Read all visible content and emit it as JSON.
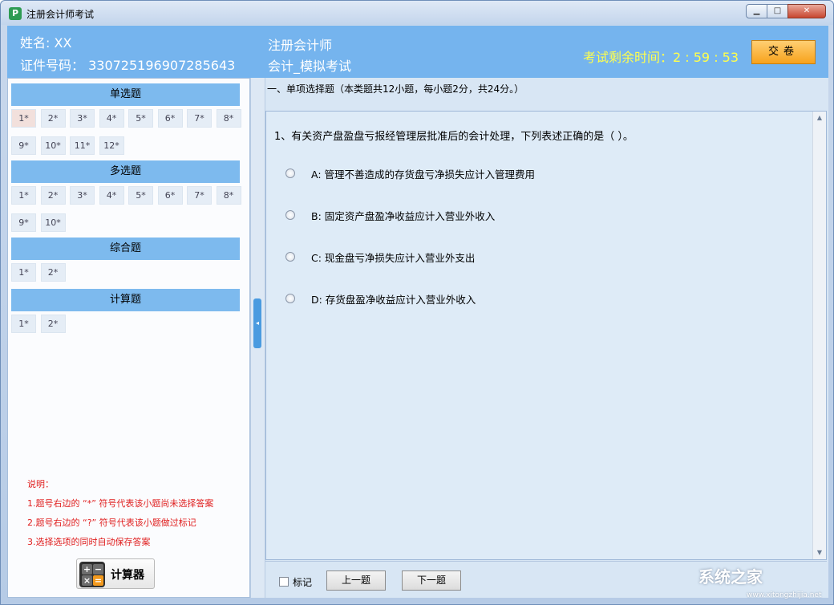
{
  "window": {
    "title": "注册会计师考试",
    "icon_letter": "P"
  },
  "header": {
    "name_label": "姓名:  XX",
    "id_label": "证件号码：  330725196907285643",
    "exam_name": "注册会计师",
    "exam_type": "会计_模拟考试",
    "timer": "考试剩余时间：2 : 59 : 53",
    "submit_label": "交卷"
  },
  "sections": [
    {
      "title": "单选题",
      "items": [
        "1*",
        "2*",
        "3*",
        "4*",
        "5*",
        "6*",
        "7*",
        "8*",
        "9*",
        "10*",
        "11*",
        "12*"
      ]
    },
    {
      "title": "多选题",
      "items": [
        "1*",
        "2*",
        "3*",
        "4*",
        "5*",
        "6*",
        "7*",
        "8*",
        "9*",
        "10*"
      ]
    },
    {
      "title": "综合题",
      "items": [
        "1*",
        "2*"
      ]
    },
    {
      "title": "计算题",
      "items": [
        "1*",
        "2*"
      ]
    }
  ],
  "notes": {
    "heading": "说明：",
    "line1": "1.题号右边的 “*” 符号代表该小题尚未选择答案",
    "line2": "2.题号右边的 “?” 符号代表该小题做过标记",
    "line3": "3.选择选项的同时自动保存答案"
  },
  "calculator": {
    "label": "计算器",
    "keys": [
      "+",
      "−",
      "×",
      "="
    ]
  },
  "question": {
    "section_title": "一、单项选择题（本类题共12小题，每小题2分，共24分。）",
    "text": "1、有关资产盘盈盘亏报经管理层批准后的会计处理，下列表述正确的是（        ）。",
    "options": [
      "A: 管理不善造成的存货盘亏净损失应计入管理费用",
      "B: 固定资产盘盈净收益应计入营业外收入",
      "C: 现金盘亏净损失应计入营业外支出",
      "D: 存货盘盈净收益应计入营业外收入"
    ]
  },
  "bottom": {
    "mark_label": "标记",
    "prev_label": "上一题",
    "next_label": "下一题"
  },
  "watermark": {
    "text": "系统之家",
    "sub": "www.xitongzhijia.net"
  }
}
